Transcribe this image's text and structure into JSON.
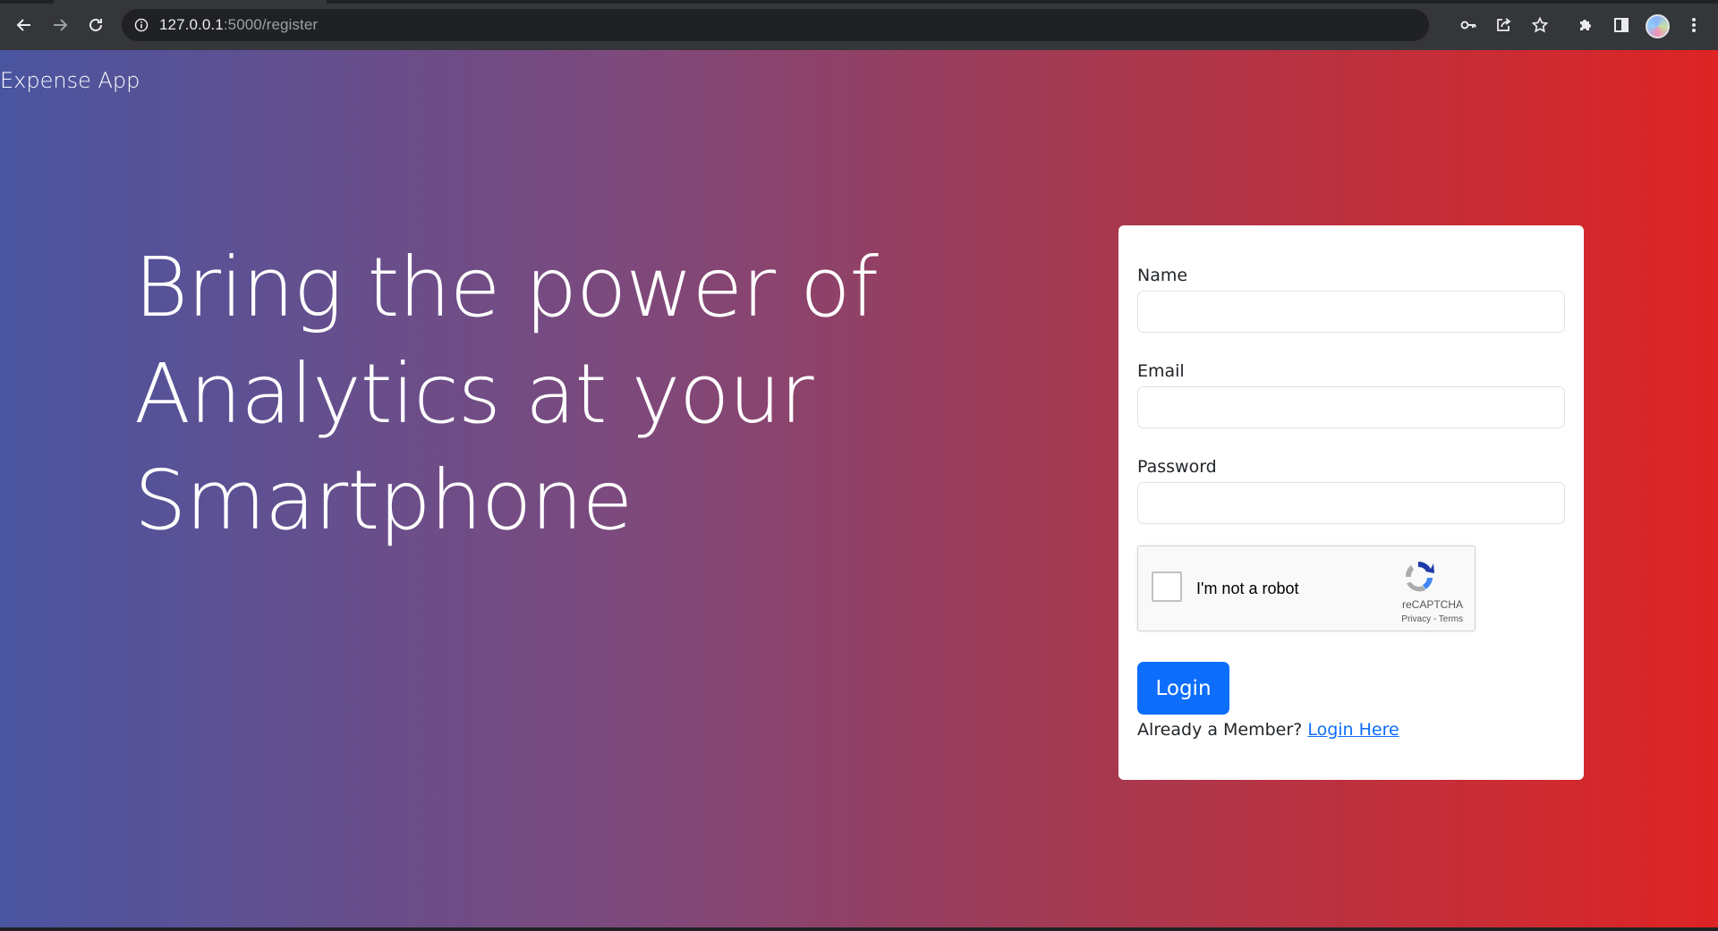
{
  "browser": {
    "url_host": "127.0.0.1",
    "url_path": ":5000/register",
    "icons": {
      "back": "back-arrow-icon",
      "forward": "forward-arrow-icon",
      "reload": "reload-icon",
      "site_info": "info-icon",
      "password": "key-icon",
      "share": "share-icon",
      "bookmark": "star-icon",
      "extensions": "puzzle-icon",
      "side_panel": "side-panel-icon",
      "menu": "kebab-menu-icon"
    }
  },
  "navbar": {
    "brand": "Expense App"
  },
  "hero": {
    "line1": "Bring the power of",
    "line2": "Analytics at your",
    "line3": "Smartphone"
  },
  "form": {
    "name_label": "Name",
    "name_value": "",
    "email_label": "Email",
    "email_value": "",
    "password_label": "Password",
    "password_value": "",
    "captcha_label": "I'm not a robot",
    "captcha_brand": "reCAPTCHA",
    "captcha_terms": "Privacy - Terms",
    "submit_label": "Login",
    "member_text": "Already a Member?",
    "login_link": "Login Here"
  },
  "colors": {
    "gradient_start": "#4a55a0",
    "gradient_end": "#de2424",
    "primary": "#0d6efd",
    "card_bg": "#ffffff"
  }
}
